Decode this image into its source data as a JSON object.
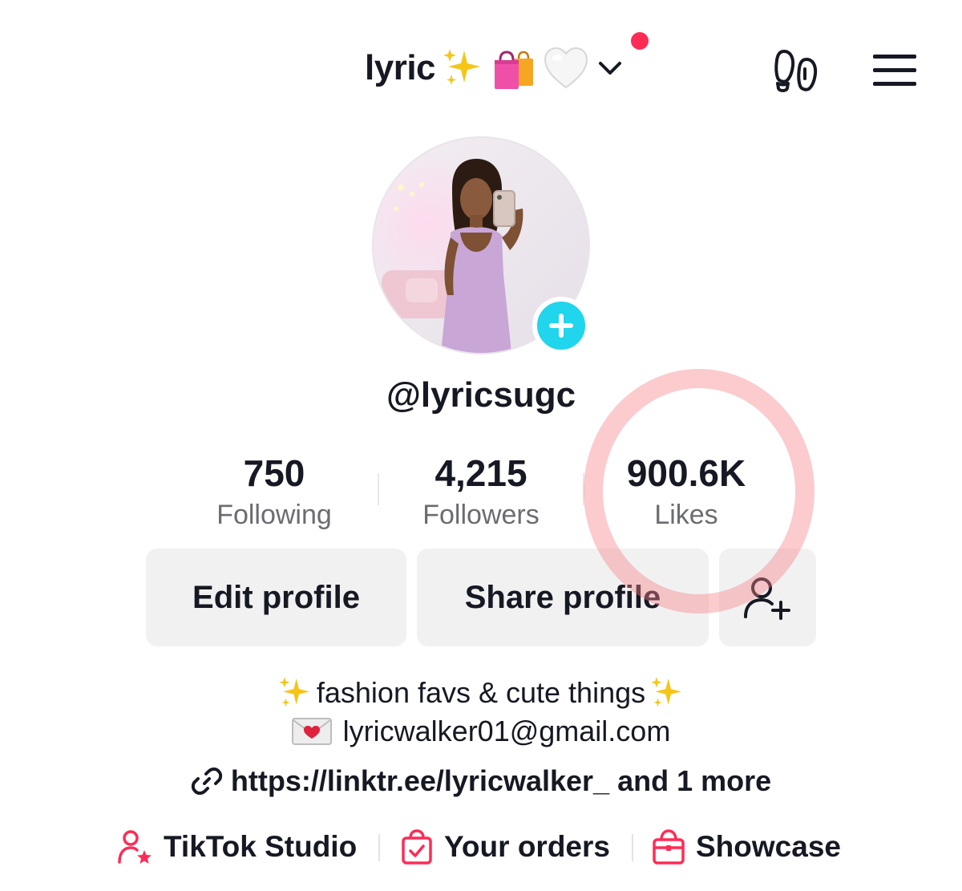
{
  "header": {
    "display_name": "lyric",
    "emojis": [
      "sparkles",
      "shopping-bags",
      "white-heart"
    ],
    "has_notification": true
  },
  "profile": {
    "username": "@lyricsugc"
  },
  "stats": [
    {
      "value": "750",
      "label": "Following"
    },
    {
      "value": "4,215",
      "label": "Followers"
    },
    {
      "value": "900.6K",
      "label": "Likes"
    }
  ],
  "actions": {
    "edit_label": "Edit profile",
    "share_label": "Share profile"
  },
  "bio": {
    "line1": "fashion favs & cute things",
    "email": "lyricwalker01@gmail.com",
    "link": "https://linktr.ee/lyricwalker_",
    "link_more": "and 1 more"
  },
  "shortcuts": [
    {
      "label": "TikTok Studio",
      "icon": "person-star-icon"
    },
    {
      "label": "Your orders",
      "icon": "order-bag-icon"
    },
    {
      "label": "Showcase",
      "icon": "shop-bag-icon"
    }
  ],
  "colors": {
    "accent": "#fe2c55",
    "avatar_add": "#20d5ec",
    "highlight_ring": "#f6848a",
    "button_bg": "#f1f1f2"
  }
}
